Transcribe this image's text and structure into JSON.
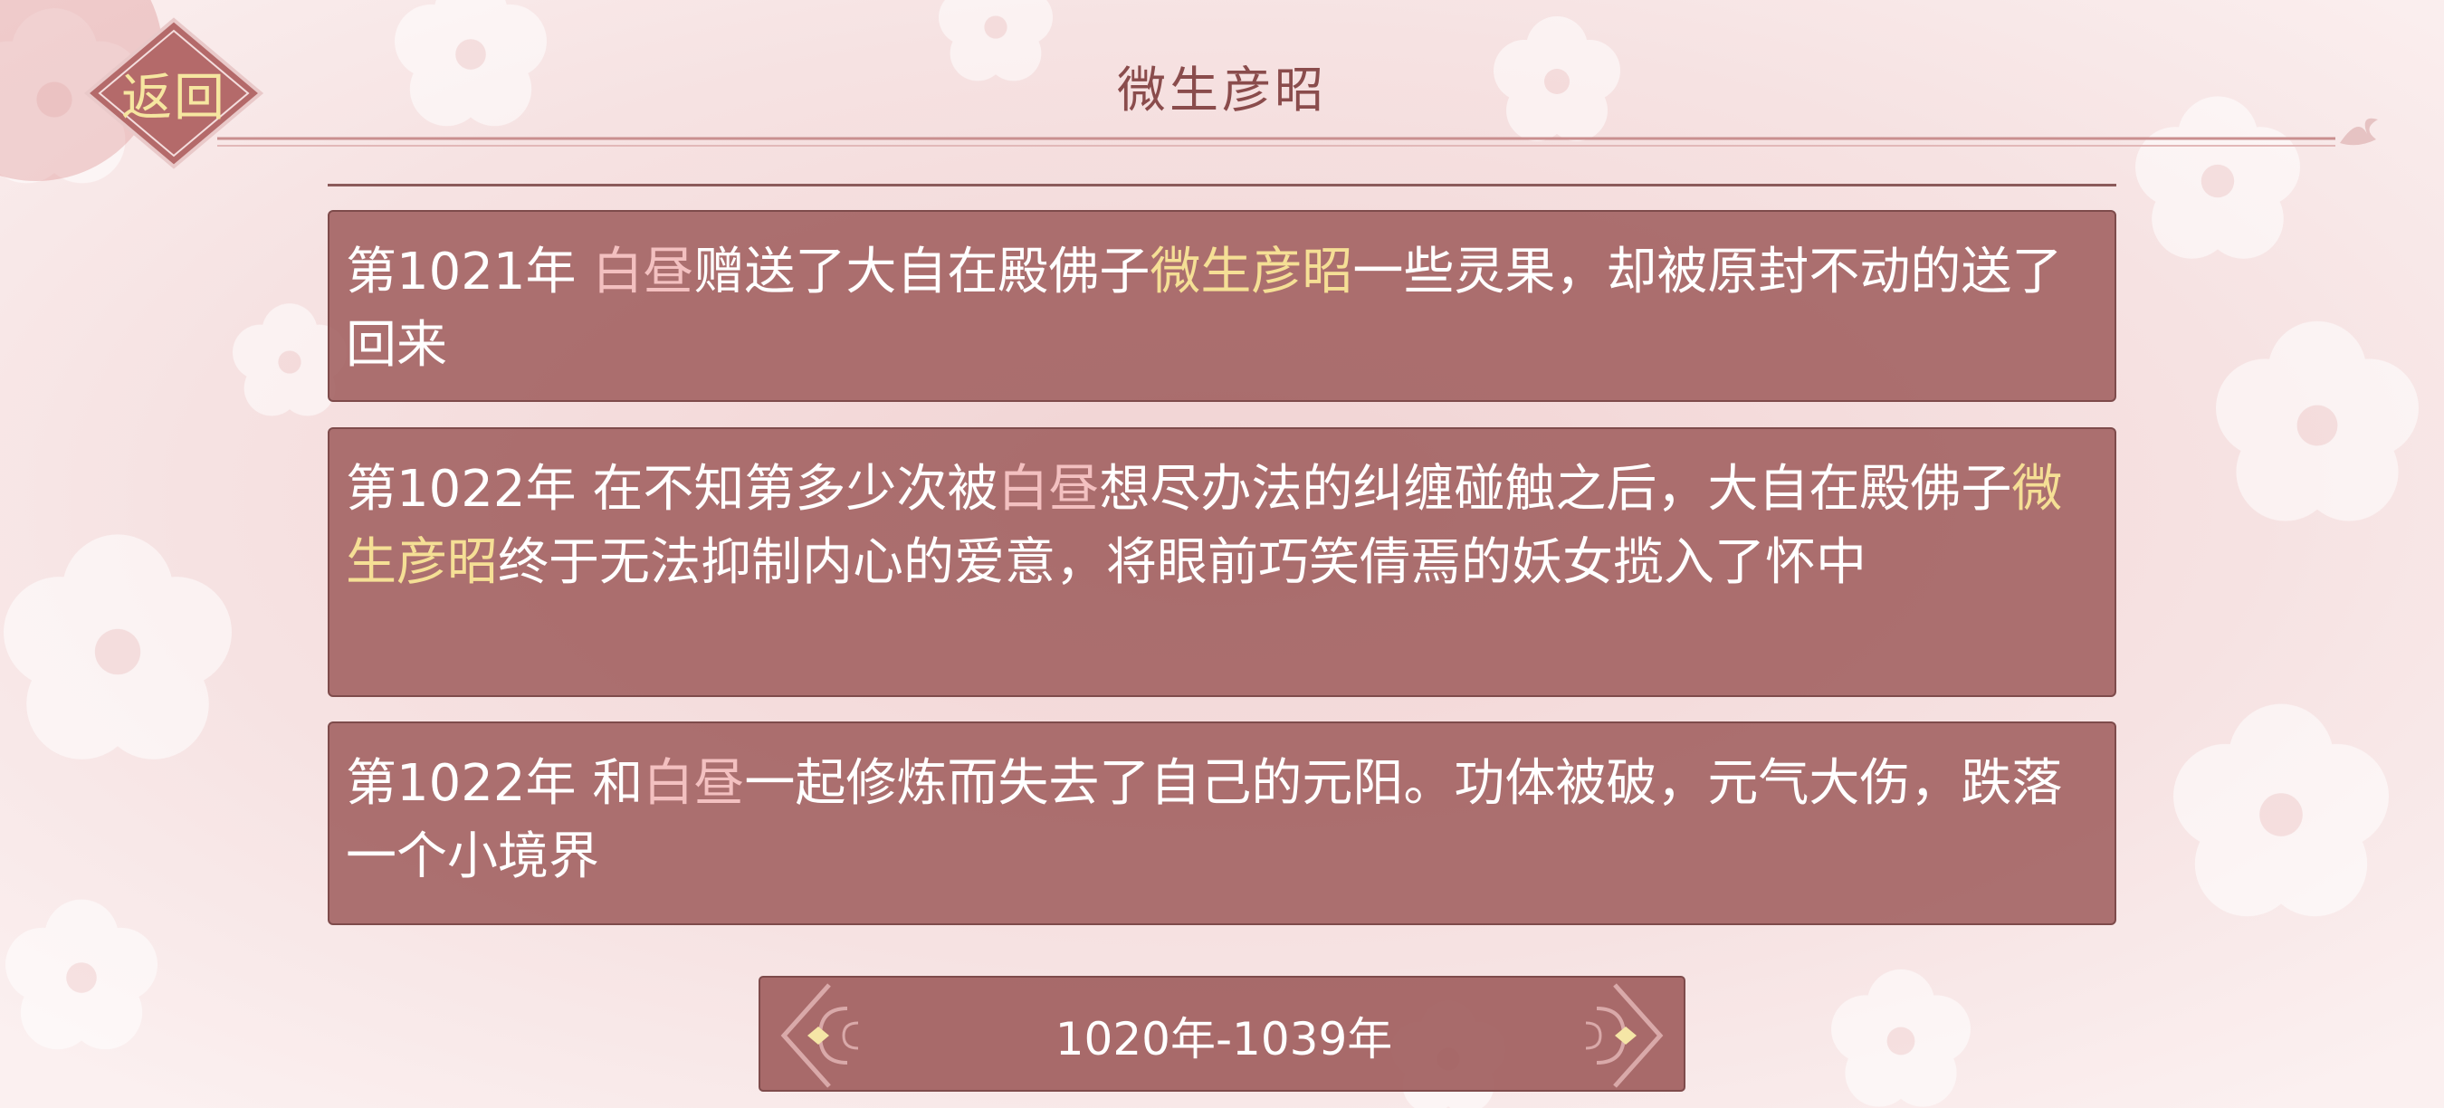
{
  "header": {
    "back_label": "返回",
    "title": "微生彦昭"
  },
  "entries": [
    {
      "year": "第1021年",
      "parts": [
        {
          "text": " ",
          "style": "white"
        },
        {
          "text": "白昼",
          "style": "pink"
        },
        {
          "text": "赠送了大自在殿佛子",
          "style": "white"
        },
        {
          "text": "微生彦昭",
          "style": "gold"
        },
        {
          "text": "一些灵果，却被原封不动的送了回来",
          "style": "white"
        }
      ]
    },
    {
      "year": "第1022年",
      "parts": [
        {
          "text": " 在不知第多少次被",
          "style": "white"
        },
        {
          "text": "白昼",
          "style": "pink"
        },
        {
          "text": "想尽办法的纠缠碰触之后，大自在殿佛子",
          "style": "white"
        },
        {
          "text": "微生彦昭",
          "style": "gold"
        },
        {
          "text": "终于无法抑制内心的爱意，将眼前巧笑倩焉的妖女揽入了怀中",
          "style": "white"
        }
      ]
    },
    {
      "year": "第1022年",
      "parts": [
        {
          "text": " 和",
          "style": "white"
        },
        {
          "text": "白昼",
          "style": "pink"
        },
        {
          "text": "一起修炼而失去了自己的元阳。功体被破，元气大伤，跌落一个小境界",
          "style": "white"
        }
      ]
    }
  ],
  "pager": {
    "label": "1020年-1039年",
    "prev_icon": "chevron-left-ornament-icon",
    "next_icon": "chevron-right-ornament-icon"
  },
  "colors": {
    "panel": "#9e5c5c",
    "highlight_pink": "#f3c0c0",
    "highlight_gold": "#f5df95",
    "title": "#8a4c4c"
  }
}
